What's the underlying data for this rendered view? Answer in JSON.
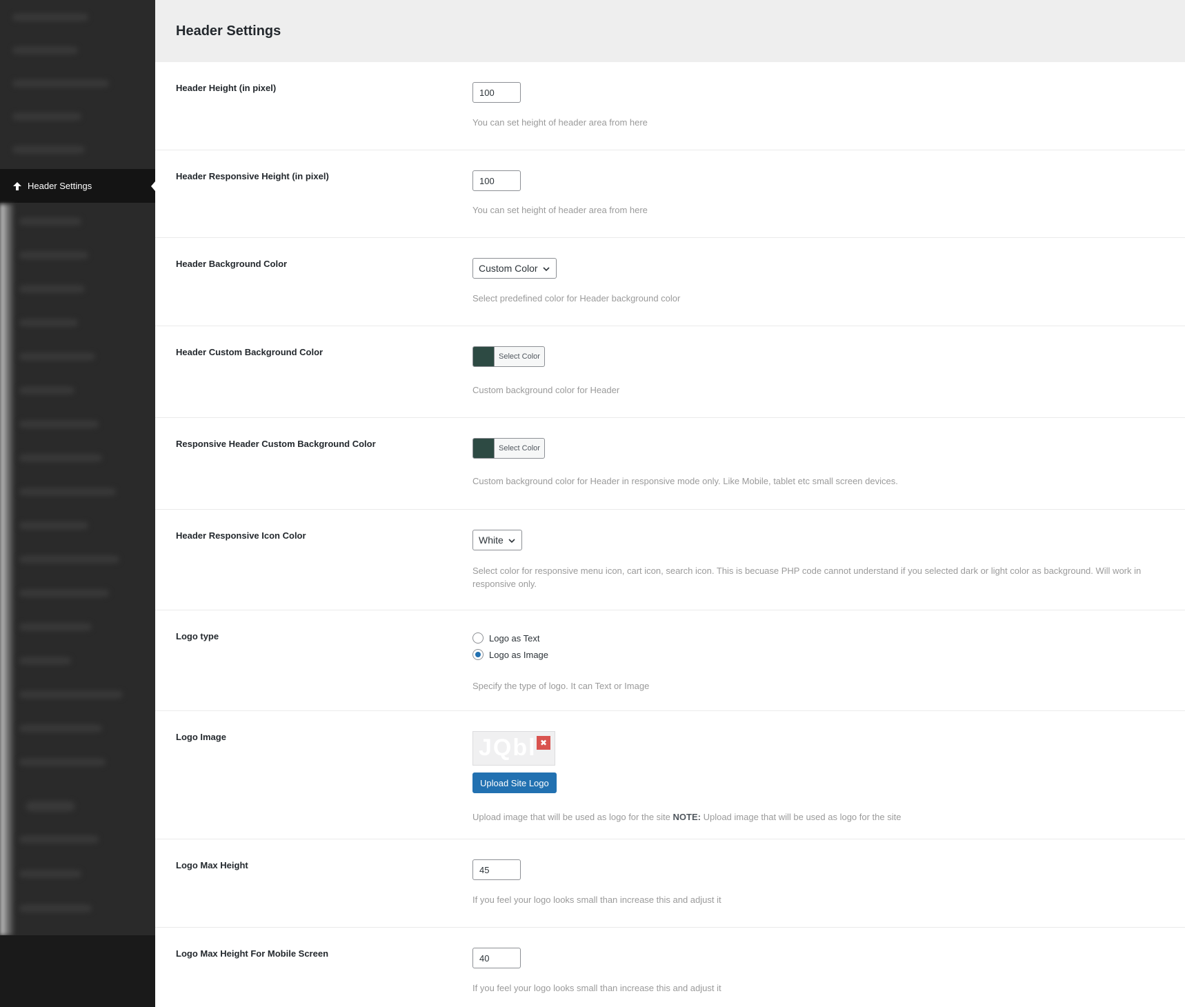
{
  "sidebar": {
    "active_item": "Header Settings"
  },
  "page": {
    "title": "Header Settings"
  },
  "fields": {
    "header_height": {
      "label": "Header Height (in pixel)",
      "value": "100",
      "desc": "You can set height of header area from here"
    },
    "header_responsive_height": {
      "label": "Header Responsive Height (in pixel)",
      "value": "100",
      "desc": "You can set height of header area from here"
    },
    "header_bg_color": {
      "label": "Header Background Color",
      "selected": "Custom Color",
      "desc": "Select predefined color for Header background color"
    },
    "header_custom_bg": {
      "label": "Header Custom Background Color",
      "button": "Select Color",
      "color": "#2d4a43",
      "desc": "Custom background color for Header"
    },
    "responsive_header_custom_bg": {
      "label": "Responsive Header Custom Background Color",
      "button": "Select Color",
      "color": "#2d4a43",
      "desc": "Custom background color for Header in responsive mode only. Like Mobile, tablet etc small screen devices."
    },
    "header_responsive_icon_color": {
      "label": "Header Responsive Icon Color",
      "selected": "White",
      "desc": "Select color for responsive menu icon, cart icon, search icon. This is becuase PHP code cannot understand if you selected dark or light color as background. Will work in responsive only."
    },
    "logo_type": {
      "label": "Logo type",
      "options": [
        "Logo as Text",
        "Logo as Image"
      ],
      "selected_index": 1,
      "desc": "Specify the type of logo. It can Text or Image"
    },
    "logo_image": {
      "label": "Logo Image",
      "upload_label": "Upload Site Logo",
      "desc_prefix": "Upload image that will be used as logo for the site ",
      "desc_note": "NOTE:",
      "desc_suffix": " Upload image that will be used as logo for the site"
    },
    "logo_max_height": {
      "label": "Logo Max Height",
      "value": "45",
      "desc": "If you feel your logo looks small than increase this and adjust it"
    },
    "logo_max_height_mobile": {
      "label": "Logo Max Height For Mobile Screen",
      "value": "40",
      "desc": "If you feel your logo looks small than increase this and adjust it"
    }
  }
}
